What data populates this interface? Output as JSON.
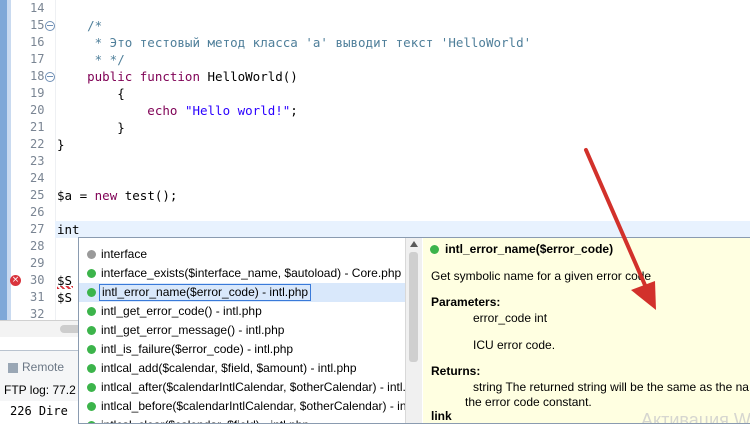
{
  "editor": {
    "lines": [
      {
        "num": "14",
        "parts": []
      },
      {
        "num": "15",
        "fold": true,
        "parts": [
          {
            "c": "cmt",
            "t": "    /*"
          }
        ]
      },
      {
        "num": "16",
        "parts": [
          {
            "c": "cmt",
            "t": "     * Это тестовый метод класса 'a' выводит текст 'HelloWorld'"
          }
        ]
      },
      {
        "num": "17",
        "parts": [
          {
            "c": "cmt",
            "t": "     * */"
          }
        ]
      },
      {
        "num": "18",
        "fold": true,
        "parts": [
          {
            "c": "kw",
            "t": "    public function"
          },
          {
            "c": "",
            "t": " HelloWorld()"
          }
        ]
      },
      {
        "num": "19",
        "parts": [
          {
            "c": "",
            "t": "        {"
          }
        ]
      },
      {
        "num": "20",
        "parts": [
          {
            "c": "kw",
            "t": "            echo "
          },
          {
            "c": "str",
            "t": "\"Hello world!\""
          },
          {
            "c": "",
            "t": ";"
          }
        ]
      },
      {
        "num": "21",
        "parts": [
          {
            "c": "",
            "t": "        }"
          }
        ]
      },
      {
        "num": "22",
        "parts": [
          {
            "c": "",
            "t": "}"
          }
        ]
      },
      {
        "num": "23",
        "parts": []
      },
      {
        "num": "24",
        "parts": []
      },
      {
        "num": "25",
        "parts": [
          {
            "c": "",
            "t": "$a = "
          },
          {
            "c": "kw",
            "t": "new"
          },
          {
            "c": "",
            "t": " test();"
          }
        ]
      },
      {
        "num": "26",
        "parts": []
      },
      {
        "num": "27",
        "current": true,
        "parts": [
          {
            "c": "",
            "t": "int"
          }
        ]
      },
      {
        "num": "28",
        "parts": []
      },
      {
        "num": "29",
        "parts": []
      },
      {
        "num": "30",
        "error": true,
        "parts": [
          {
            "c": "",
            "t": "$S"
          }
        ]
      },
      {
        "num": "31",
        "parts": [
          {
            "c": "",
            "t": "$S"
          }
        ]
      },
      {
        "num": "32",
        "parts": []
      }
    ],
    "error_icon": "error-x-icon"
  },
  "bottom": {
    "tab_label": "Remote",
    "ftp_log": "FTP log: 77.2",
    "dir_line": "226 Dire"
  },
  "autocomplete": {
    "items": [
      {
        "label": "interface",
        "icon": "gray",
        "selected": false
      },
      {
        "label": "interface_exists($interface_name, $autoload) - Core.php",
        "icon": "green",
        "selected": false
      },
      {
        "label": "intl_error_name($error_code) - intl.php",
        "icon": "green",
        "selected": true
      },
      {
        "label": "intl_get_error_code() - intl.php",
        "icon": "green",
        "selected": false
      },
      {
        "label": "intl_get_error_message() - intl.php",
        "icon": "green",
        "selected": false
      },
      {
        "label": "intl_is_failure($error_code) - intl.php",
        "icon": "green",
        "selected": false
      },
      {
        "label": "intlcal_add($calendar, $field, $amount) - intl.php",
        "icon": "green",
        "selected": false
      },
      {
        "label": "intlcal_after($calendarIntlCalendar, $otherCalendar) - intl.",
        "icon": "green",
        "selected": false
      },
      {
        "label": "intlcal_before($calendarIntlCalendar, $otherCalendar) - in",
        "icon": "green",
        "selected": false
      },
      {
        "label": "intlcal_clear($calendar, $field) - intl.php",
        "icon": "green",
        "selected": false
      }
    ],
    "colors": {
      "green": "#3cb44b",
      "gray": "#9a9a9a"
    }
  },
  "doc": {
    "title": "intl_error_name($error_code)",
    "summary": "Get symbolic name for a given error code",
    "params_heading": "Parameters:",
    "param": "error_code int",
    "param_desc": "ICU error code.",
    "returns_heading": "Returns:",
    "returns_line1": "string The returned string will be the same as the na",
    "returns_line2": "the error code constant.",
    "link_heading": "link",
    "watermark": "Активация W"
  }
}
